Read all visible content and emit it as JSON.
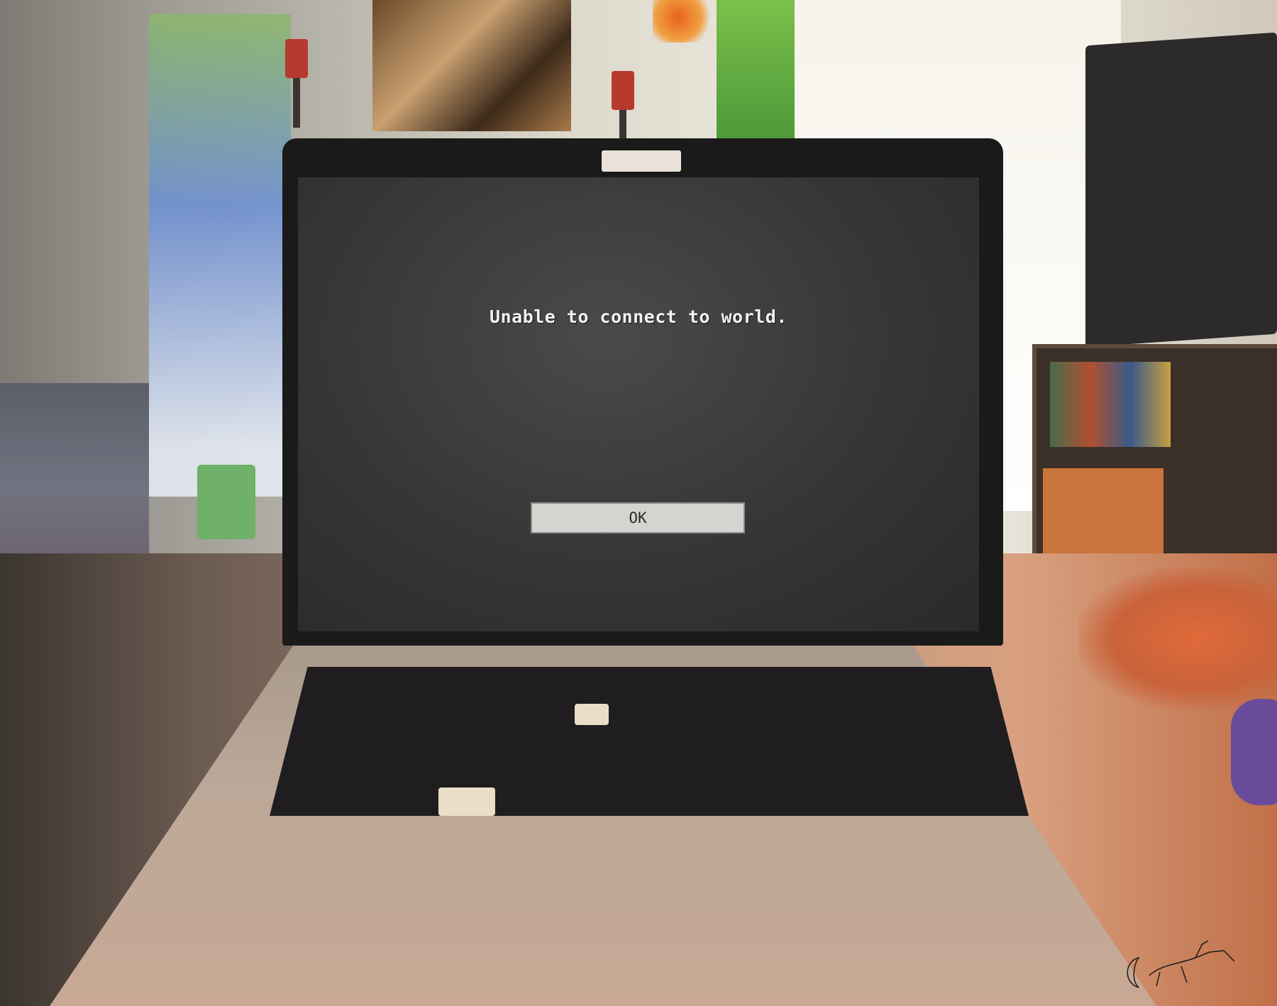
{
  "dialog": {
    "message": "Unable to connect to world.",
    "ok_label": "OK"
  },
  "colors": {
    "screen_background": "#343436",
    "button_face": "#d4d4d0",
    "message_text": "#f2f2f0"
  }
}
